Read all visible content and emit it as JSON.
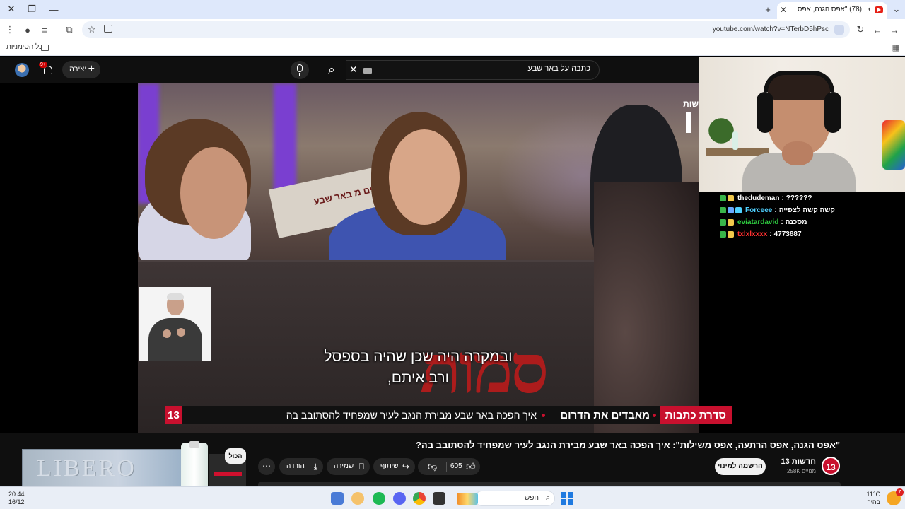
{
  "browser": {
    "tab_title": "(78) \"אפס הגנה, אפס הרתעה...",
    "url": "youtube.com/watch?v=NTerbD5hPsc",
    "bookmarks_all": "כל הסימניות"
  },
  "youtube": {
    "notifications_badge": "9+",
    "create_label": "יצירה",
    "search_value": "כתבה על באר שבע",
    "video": {
      "banner_text": "ים הבאים מ באר שבע",
      "sign_text": "סמות",
      "corner_logo": "שות",
      "subtitle_line1": "ובמקרה היה שכן שהיה בספסל",
      "subtitle_line2": "ורב איתם,",
      "ticker_logo": "13",
      "ticker_series": "סדרת כתבות",
      "ticker_show": "מאבדים את הדרום",
      "ticker_desc": "איך הפכה באר שבע מבירת הנגב לעיר שמפחיד להסתובב בה"
    },
    "title": "\"אפס הגנה, אפס הרתעה, אפס משילות\": איך הפכה באר שבע מבירת הנגב לעיר שמפחיד להסתובב בה?",
    "channel": {
      "logo": "13",
      "name": "חדשות 13",
      "subscribers": "258K מנויים",
      "subscribe_label": "הרשמה למינוי"
    },
    "actions": {
      "likes": "605",
      "share": "שיתוף",
      "save": "שמירה",
      "download": "הורדה"
    },
    "chips": {
      "all": "הכול"
    },
    "ad": {
      "brand": "LIBERO"
    }
  },
  "stream": {
    "chat": [
      {
        "user": "thedudeman",
        "message": "??????",
        "color": "#ffffff"
      },
      {
        "user": "Forceee",
        "message": "קשה קשה לצפייה",
        "color": "#4fd1ff"
      },
      {
        "user": "eviatardavid",
        "message": "מסכנה",
        "color": "#2ecc40"
      },
      {
        "user": "txlxlxxxx",
        "message": "4773887",
        "color": "#ff3030"
      }
    ]
  },
  "taskbar": {
    "time": "20:44",
    "date": "16/12",
    "search_placeholder": "חפש",
    "temperature": "11°C",
    "weather_desc": "בהיר",
    "notification_count": "7"
  }
}
